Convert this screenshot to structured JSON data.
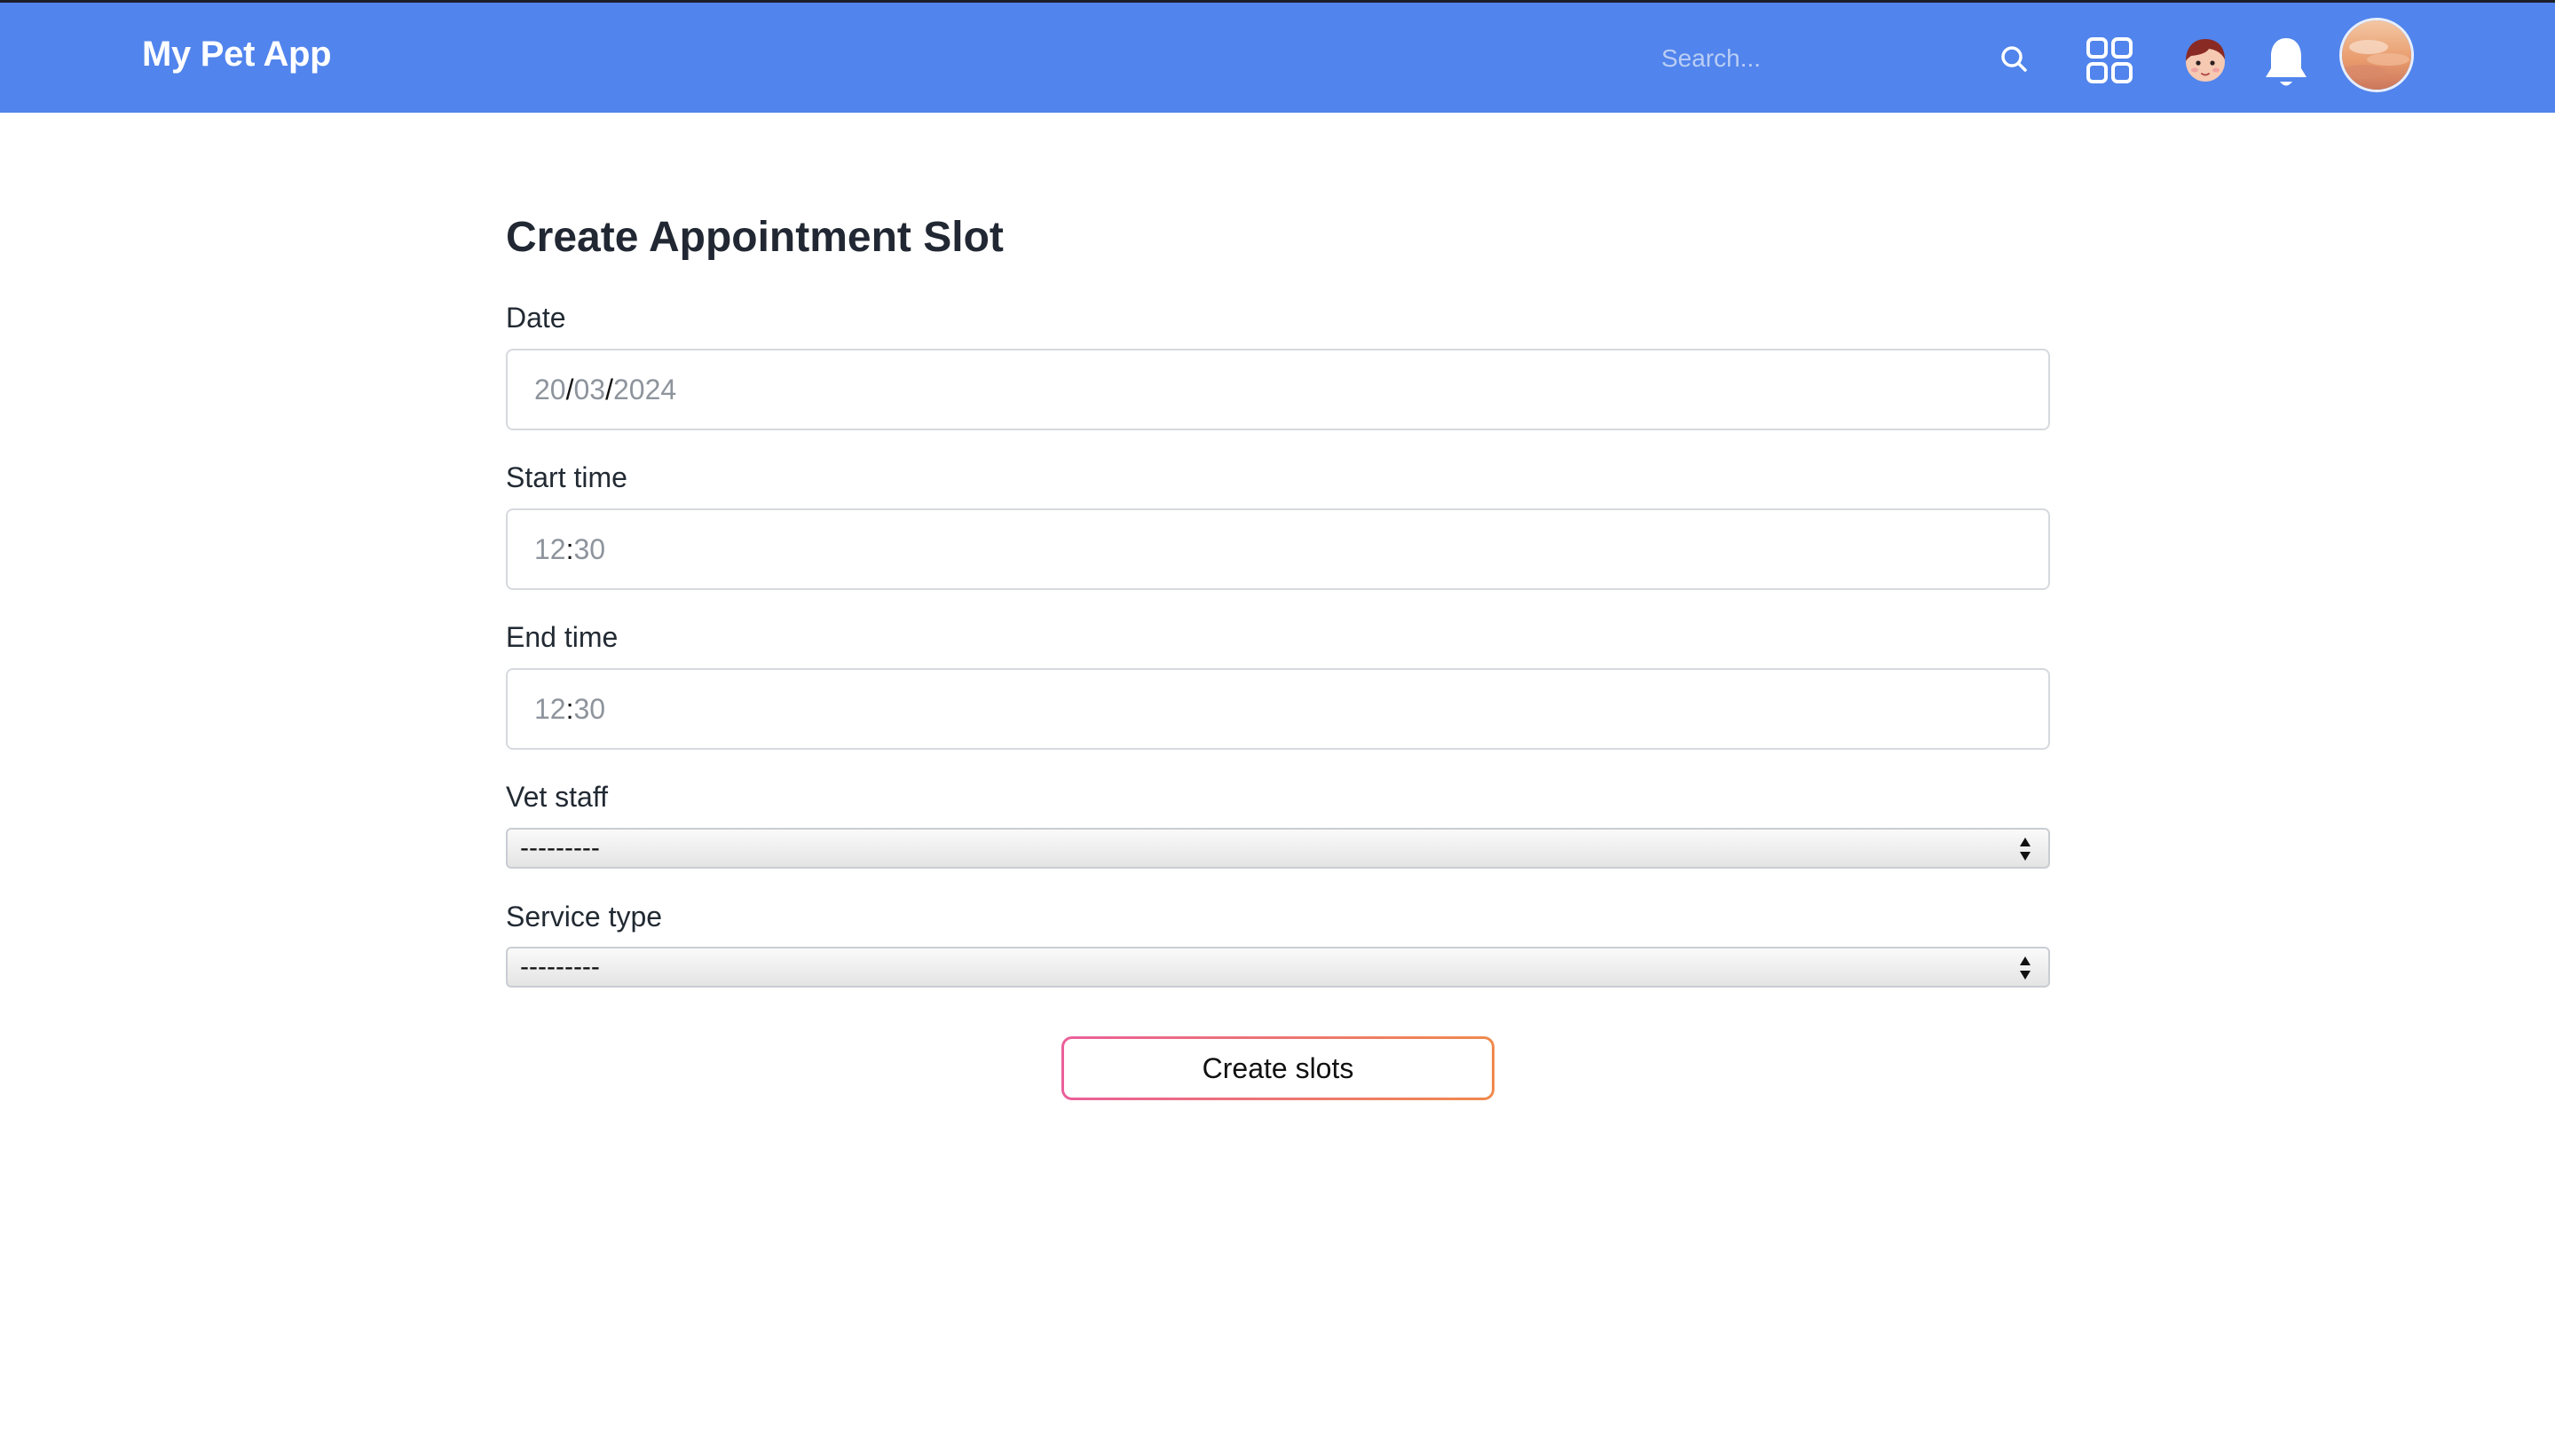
{
  "header": {
    "brand": "My Pet App",
    "search_placeholder": "Search...",
    "background_color": "#5184ec",
    "icons": [
      "search-icon",
      "apps-grid-icon",
      "face-avatar-icon",
      "bell-icon",
      "profile-avatar"
    ]
  },
  "form": {
    "title": "Create Appointment Slot",
    "date": {
      "label": "Date",
      "day": "20",
      "month": "03",
      "year": "2024",
      "separator": "/"
    },
    "start_time": {
      "label": "Start time",
      "hour": "12",
      "minute": "30",
      "separator": ":"
    },
    "end_time": {
      "label": "End time",
      "hour": "12",
      "minute": "30",
      "separator": ":"
    },
    "vet_staff": {
      "label": "Vet staff",
      "selected": "---------"
    },
    "service_type": {
      "label": "Service type",
      "selected": "---------"
    },
    "submit_label": "Create slots",
    "submit_gradient": [
      "#ea5f9a",
      "#f08a4c"
    ]
  }
}
